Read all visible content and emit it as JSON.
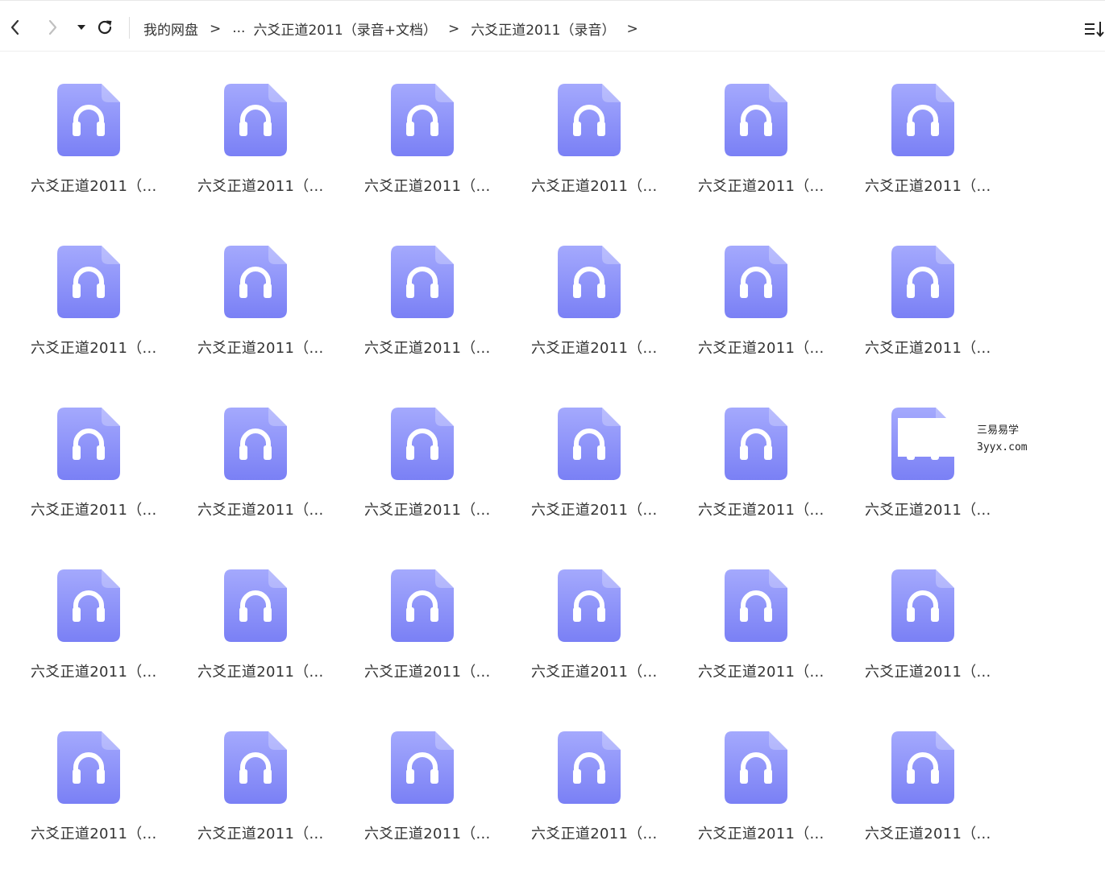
{
  "toolbar": {
    "back_icon": "chevron-left-icon",
    "forward_icon": "chevron-right-icon",
    "history_icon": "caret-down-icon",
    "refresh_icon": "refresh-icon",
    "sort_icon": "sort-list-icon"
  },
  "breadcrumb": {
    "items": [
      {
        "label": "我的网盘"
      },
      {
        "label": "..."
      },
      {
        "label": "六爻正道2011（录音+文档）"
      },
      {
        "label": "六爻正道2011（录音）"
      }
    ],
    "separator": ">"
  },
  "files": [
    {
      "name": "六爻正道2011（..."
    },
    {
      "name": "六爻正道2011（..."
    },
    {
      "name": "六爻正道2011（..."
    },
    {
      "name": "六爻正道2011（..."
    },
    {
      "name": "六爻正道2011（..."
    },
    {
      "name": "六爻正道2011（..."
    },
    {
      "name": "六爻正道2011（..."
    },
    {
      "name": "六爻正道2011（..."
    },
    {
      "name": "六爻正道2011（..."
    },
    {
      "name": "六爻正道2011（..."
    },
    {
      "name": "六爻正道2011（..."
    },
    {
      "name": "六爻正道2011（..."
    },
    {
      "name": "六爻正道2011（..."
    },
    {
      "name": "六爻正道2011（..."
    },
    {
      "name": "六爻正道2011（..."
    },
    {
      "name": "六爻正道2011（..."
    },
    {
      "name": "六爻正道2011（..."
    },
    {
      "name": "六爻正道2011（..."
    },
    {
      "name": "六爻正道2011（..."
    },
    {
      "name": "六爻正道2011（..."
    },
    {
      "name": "六爻正道2011（..."
    },
    {
      "name": "六爻正道2011（..."
    },
    {
      "name": "六爻正道2011（..."
    },
    {
      "name": "六爻正道2011（..."
    },
    {
      "name": "六爻正道2011（..."
    },
    {
      "name": "六爻正道2011（..."
    },
    {
      "name": "六爻正道2011（..."
    },
    {
      "name": "六爻正道2011（..."
    },
    {
      "name": "六爻正道2011（..."
    },
    {
      "name": "六爻正道2011（..."
    }
  ],
  "file_icon": "audio-file-icon",
  "colors": {
    "icon_top": "#a4a9fd",
    "icon_bottom": "#7a80f5",
    "text": "#333333"
  },
  "watermark": {
    "line1": "三易易学",
    "line2": "3yyx.com"
  }
}
